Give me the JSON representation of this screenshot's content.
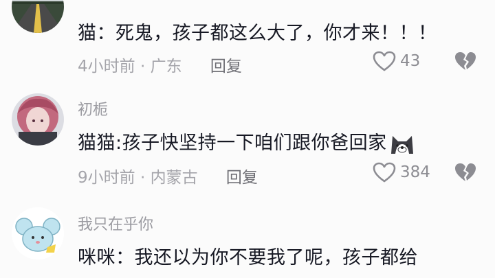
{
  "comments": [
    {
      "username": "",
      "text": "猫：死鬼，孩子都这么大了，你才来！！！",
      "time": "4小时前",
      "location": "广东",
      "reply_label": "回复",
      "likes": "43"
    },
    {
      "username": "初栀",
      "text": "猫猫:孩子快坚持一下咱们跟你爸回家",
      "time": "9小时前",
      "location": "内蒙古",
      "reply_label": "回复",
      "likes": "384"
    },
    {
      "username": "我只在乎你",
      "text": "咪咪：我还以为你不要我了呢，孩子都给",
      "time": "",
      "location": "",
      "reply_label": "",
      "likes": ""
    }
  ],
  "icons": {
    "like": "heart-outline-icon",
    "dislike": "broken-heart-icon",
    "emoji": "husky-emoji-icon"
  },
  "colors": {
    "text": "#161823",
    "meta": "#a4a4aa",
    "background": "#fbfbfb"
  }
}
